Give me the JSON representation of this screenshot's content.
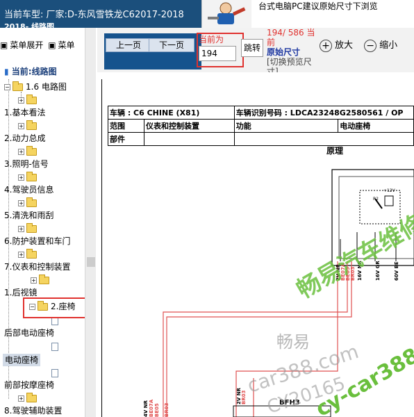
{
  "header": {
    "car_model": "当前车型:   厂家:D-东风雪铁龙C62017-2018",
    "path": "2018- 线路图.",
    "hint": "台式电脑PC建议原始尺寸下浏览"
  },
  "sidebar": {
    "menu_expand": "菜单展开",
    "menu_collapse": "菜单",
    "current": "当前:线路图",
    "tree": [
      {
        "label": "1.6 电路图",
        "type": "folder"
      },
      {
        "label": "",
        "type": "folder"
      },
      {
        "label": "1.基本看法",
        "type": "text"
      },
      {
        "label": "",
        "type": "folder"
      },
      {
        "label": "2.动力总成",
        "type": "text"
      },
      {
        "label": "",
        "type": "folder"
      },
      {
        "label": "3.照明-信号",
        "type": "text"
      },
      {
        "label": "",
        "type": "folder"
      },
      {
        "label": "4.驾驶员信息",
        "type": "text"
      },
      {
        "label": "",
        "type": "folder"
      },
      {
        "label": "5.清洗和雨刮",
        "type": "text"
      },
      {
        "label": "",
        "type": "folder"
      },
      {
        "label": "6.防护装置和车门",
        "type": "text"
      },
      {
        "label": "",
        "type": "folder"
      },
      {
        "label": "7.仪表和控制装置",
        "type": "text"
      },
      {
        "label": "",
        "type": "folder"
      },
      {
        "label": "1.后视镜",
        "type": "text"
      },
      {
        "label": "2.座椅",
        "type": "folder"
      },
      {
        "label": "",
        "type": "doc"
      },
      {
        "label": "后部电动座椅",
        "type": "text"
      },
      {
        "label": "",
        "type": "doc"
      },
      {
        "label": "电动座椅",
        "type": "text"
      },
      {
        "label": "",
        "type": "doc"
      },
      {
        "label": "前部按摩座椅",
        "type": "text"
      },
      {
        "label": "",
        "type": "folder"
      },
      {
        "label": "8.驾驶辅助装置",
        "type": "text"
      }
    ]
  },
  "toolbar": {
    "prev": "上一页",
    "next": "下一页",
    "current_label": "当前为",
    "page_value": "194",
    "jump": "跳转",
    "page_count": "194/ 586 当前",
    "original_size": "原始尺寸",
    "switch_preview": "[切换预览尺寸]",
    "zoom_in": "放大",
    "zoom_out": "缩小"
  },
  "document": {
    "row1_vehicle": "车辆 : C6 CHINE (X81)",
    "row1_vin_label": "车辆识别号码 : LDCA23248G2580561 / OP",
    "row2_range": "范围",
    "row2_range_value": "仪表和控制装置",
    "row2_function": "功能",
    "row2_function_value": "电动座椅",
    "row3_parts": "部件",
    "diagram_title": "原理",
    "connector_label": "BFH3",
    "wire_labels": [
      "2V NR",
      "BE07A",
      "BE05",
      "BR03",
      "16V NR",
      "16V GR",
      "60V BE",
      "R2",
      "2V NR",
      "BR03"
    ],
    "relay_label": "+12V"
  },
  "watermarks": {
    "brand": "畅易汽车维修",
    "brand_short": "畅易",
    "site": "car388.com",
    "code": "CY20165",
    "site2": "cy-car388"
  },
  "colors": {
    "header_bg": "#1b4f7c",
    "accent_red": "#e0312e",
    "watermark_green": "#6abf3d",
    "wire_red": "#e05050",
    "link_blue": "#1b35a0"
  }
}
